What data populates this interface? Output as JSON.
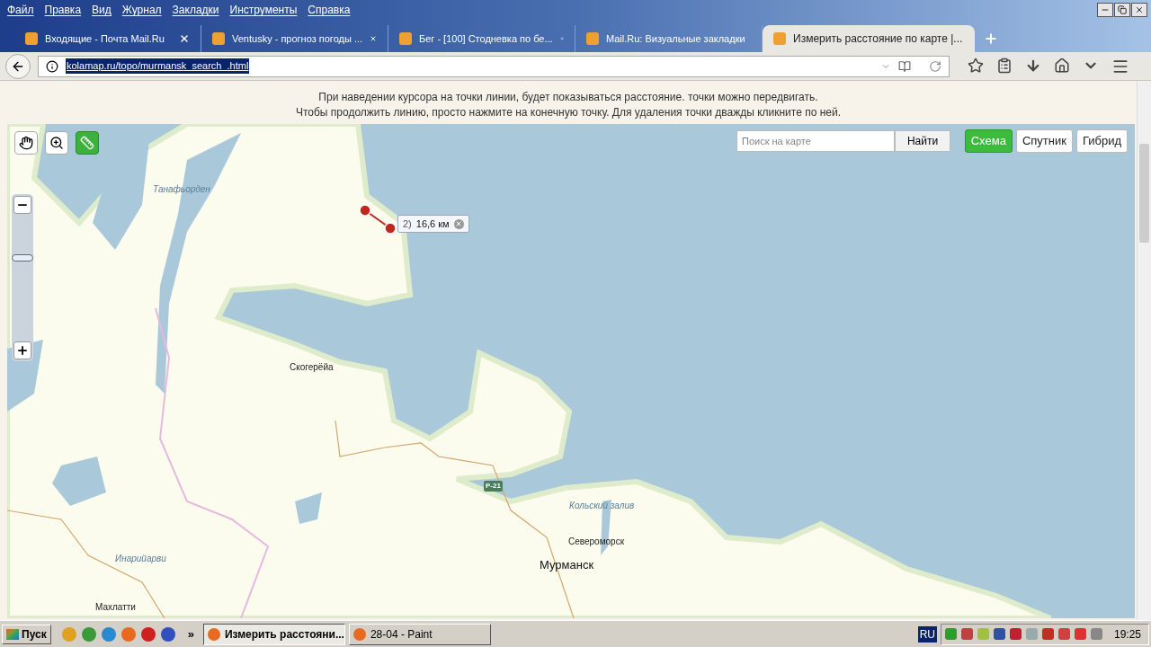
{
  "menu": [
    "Файл",
    "Правка",
    "Вид",
    "Журнал",
    "Закладки",
    "Инструменты",
    "Справка"
  ],
  "tabs": [
    {
      "title": "Входящие - Почта Mail.Ru",
      "selected": false
    },
    {
      "title": "Ventusky - прогноз погоды ...",
      "selected": false
    },
    {
      "title": "Бег - [100] Стодневка по бе...",
      "selected": false
    },
    {
      "title": "Mail.Ru: Визуальные закладки",
      "selected": false
    },
    {
      "title": "Измерить расстояние по карте |...",
      "selected": true
    }
  ],
  "address": "kolamap.ru/topo/murmansk_search_.html",
  "page": {
    "instructions": [
      "При наведении курсора на точки линии, будет показываться расстояние. точки можно передвигать.",
      "Чтобы продолжить линию, просто нажмите на конечную точку. Для удаления точки дважды кликните по ней."
    ],
    "tools": [
      {
        "kind": "pan",
        "selected": false
      },
      {
        "kind": "zoom",
        "selected": false
      },
      {
        "kind": "ruler",
        "selected": true
      }
    ],
    "zoom": {
      "level": 0.63
    },
    "search": {
      "placeholder": "Поиск на карте",
      "button": "Найти"
    },
    "map_types": [
      {
        "label": "Схема",
        "selected": true
      },
      {
        "label": "Спутник",
        "selected": false
      },
      {
        "label": "Гибрид",
        "selected": false
      }
    ],
    "measurement": {
      "index": "2)",
      "distance": "16,6 км"
    },
    "labels": [
      {
        "text": "Танафьорден",
        "kind": "water"
      },
      {
        "text": "Скогерёйа",
        "kind": "town"
      },
      {
        "text": "Р-21",
        "kind": "road"
      },
      {
        "text": "Кольский залив",
        "kind": "water"
      },
      {
        "text": "Североморск",
        "kind": "town"
      },
      {
        "text": "Инарийарви",
        "kind": "water"
      },
      {
        "text": "Мурманск",
        "kind": "city"
      },
      {
        "text": "Махлатти",
        "kind": "town"
      }
    ]
  },
  "taskbar": {
    "start": "Пуск",
    "more": "»",
    "tasks": [
      {
        "title": "Измерить расстояни...",
        "selected": true
      },
      {
        "title": "28-04 - Paint",
        "selected": false
      }
    ],
    "language": "RU",
    "clock": "19:25"
  }
}
